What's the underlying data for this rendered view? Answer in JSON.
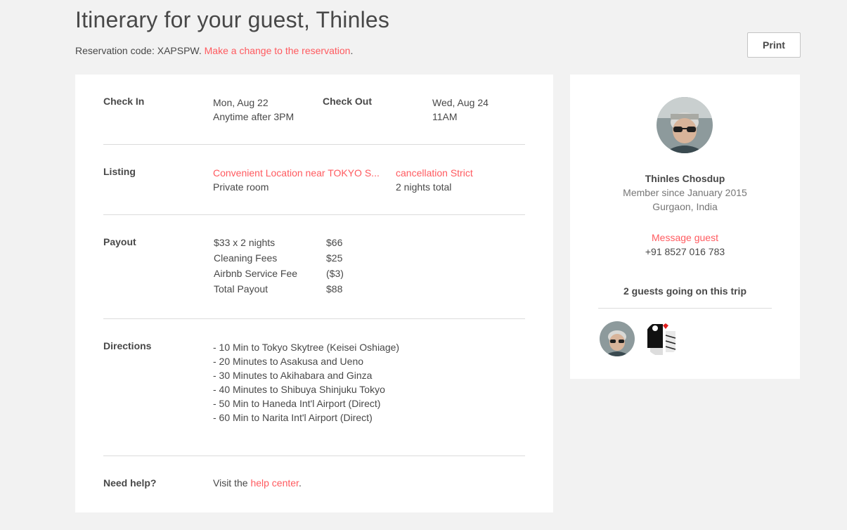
{
  "header": {
    "title": "Itinerary for your guest, Thinles",
    "reservation_prefix": "Reservation code: XAPSPW. ",
    "change_link": "Make a change to the reservation",
    "change_suffix": ".",
    "print_label": "Print"
  },
  "checkin": {
    "label": "Check In",
    "date": "Mon, Aug 22",
    "time": "Anytime after 3PM"
  },
  "checkout": {
    "label": "Check Out",
    "date": "Wed, Aug 24",
    "time": "11AM"
  },
  "listing": {
    "label": "Listing",
    "name": "Convenient Location near TOKYO S...",
    "type": "Private room",
    "cancellation": "cancellation Strict",
    "nights": "2 nights total"
  },
  "payout": {
    "label": "Payout",
    "rows": [
      {
        "name": "$33 x 2 nights",
        "amount": "$66"
      },
      {
        "name": "Cleaning Fees",
        "amount": "$25"
      },
      {
        "name": "Airbnb Service Fee",
        "amount": "($3)"
      },
      {
        "name": "Total Payout",
        "amount": "$88"
      }
    ]
  },
  "directions": {
    "label": "Directions",
    "items": [
      "- 10 Min to Tokyo Skytree (Keisei Oshiage)",
      "- 20 Minutes to Asakusa and Ueno",
      "- 30 Minutes to Akihabara and Ginza",
      "- 40 Minutes to Shibuya Shinjuku Tokyo",
      "- 50 Min to Haneda Int'l Airport (Direct)",
      "- 60 Min to Narita Int'l Airport (Direct)"
    ]
  },
  "help": {
    "label": "Need help?",
    "prefix": "Visit the ",
    "link": "help center",
    "suffix": "."
  },
  "guest": {
    "name": "Thinles Chosdup",
    "member_since": "Member since January 2015",
    "location": "Gurgaon, India",
    "message_link": "Message guest",
    "phone": "+91 8527 016 783",
    "guests_heading": "2 guests going on this trip"
  },
  "colors": {
    "accent": "#ff5a5f",
    "text": "#484848",
    "background": "#f2f2f2"
  }
}
